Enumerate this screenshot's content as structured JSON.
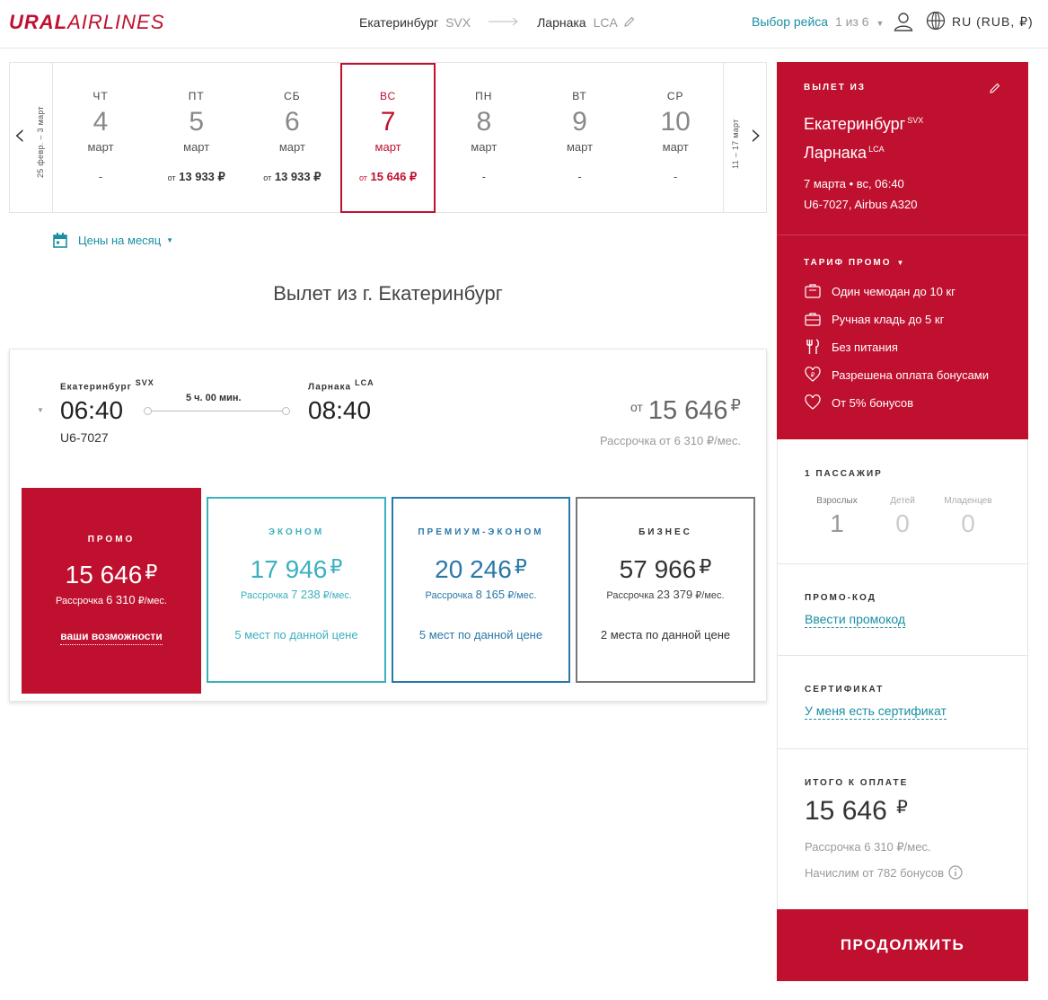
{
  "header": {
    "logo_bold": "URAL",
    "logo_thin": "AIRLINES",
    "from_city": "Екатеринбург",
    "from_code": "SVX",
    "to_city": "Ларнака",
    "to_code": "LCA",
    "flight_select_label": "Выбор рейса",
    "flight_select_count": "1 из 6",
    "language": "RU (RUB, ₽)"
  },
  "date_strip": {
    "prev_range": "25 февр. – 3 март",
    "next_range": "11 – 17 март",
    "days": [
      {
        "dow": "чт",
        "num": "4",
        "month": "март",
        "price_prefix": "",
        "price": "-"
      },
      {
        "dow": "пт",
        "num": "5",
        "month": "март",
        "price_prefix": "от",
        "price": "13 933 ₽"
      },
      {
        "dow": "сб",
        "num": "6",
        "month": "март",
        "price_prefix": "от",
        "price": "13 933 ₽"
      },
      {
        "dow": "вс",
        "num": "7",
        "month": "март",
        "price_prefix": "от",
        "price": "15 646 ₽"
      },
      {
        "dow": "пн",
        "num": "8",
        "month": "март",
        "price_prefix": "",
        "price": "-"
      },
      {
        "dow": "вт",
        "num": "9",
        "month": "март",
        "price_prefix": "",
        "price": "-"
      },
      {
        "dow": "ср",
        "num": "10",
        "month": "март",
        "price_prefix": "",
        "price": "-"
      }
    ],
    "selected_index": 3
  },
  "month_prices_label": "Цены на месяц",
  "section_title": "Вылет из г. Екатеринбург",
  "flight": {
    "from_city": "Екатеринбург",
    "from_code": "SVX",
    "to_city": "Ларнака",
    "to_code": "LCA",
    "dep_time": "06:40",
    "arr_time": "08:40",
    "duration": "5 ч. 00 мин.",
    "flight_no": "U6-7027",
    "price_prefix": "от",
    "price": "15 646",
    "currency": "₽",
    "installment": "Рассрочка от 6 310 ₽/мес."
  },
  "fares": {
    "promo": {
      "name": "Промо",
      "price": "15 646",
      "currency": "₽",
      "inst_prefix": "Рассрочка",
      "inst_value": "6 310",
      "inst_suffix": "₽/мес.",
      "link": "ваши возможности"
    },
    "econ": {
      "name": "Эконом",
      "price": "17 946",
      "currency": "₽",
      "inst_prefix": "Рассрочка",
      "inst_value": "7 238",
      "inst_suffix": "₽/мес.",
      "avail": "5 мест по данной цене"
    },
    "prem": {
      "name": "Премиум-эконом",
      "price": "20 246",
      "currency": "₽",
      "inst_prefix": "Рассрочка",
      "inst_value": "8 165",
      "inst_suffix": "₽/мес.",
      "avail": "5 мест по данной цене"
    },
    "biz": {
      "name": "Бизнес",
      "price": "57 966",
      "currency": "₽",
      "inst_prefix": "Рассрочка",
      "inst_value": "23 379",
      "inst_suffix": "₽/мес.",
      "avail": "2 места по данной цене"
    }
  },
  "sidebar": {
    "departure_label": "Вылет из",
    "from_city": "Екатеринбург",
    "from_code": "SVX",
    "to_city": "Ларнака",
    "to_code": "LCA",
    "date_line": "7 марта • вс, 06:40",
    "flight_line": "U6-7027, Airbus A320",
    "tariff_label": "Тариф промо",
    "features": [
      {
        "icon": "suitcase-icon",
        "text": "Один чемодан до 10 кг"
      },
      {
        "icon": "hand-luggage-icon",
        "text": "Ручная кладь до 5 кг"
      },
      {
        "icon": "meal-icon",
        "text": "Без питания"
      },
      {
        "icon": "bonus-heart-icon",
        "text": "Разрешена оплата бонусами"
      },
      {
        "icon": "heart-icon",
        "text": "От 5% бонусов"
      }
    ],
    "pax_label": "1 пассажир",
    "adults_label": "Взрослых",
    "adults": "1",
    "children_label": "Детей",
    "children": "0",
    "infants_label": "Младенцев",
    "infants": "0",
    "promo_label": "Промо-код",
    "promo_link": "Ввести промокод",
    "cert_label": "Сертификат",
    "cert_link": "У меня есть сертификат",
    "total_label": "Итого к оплате",
    "total_price": "15 646",
    "total_currency": "₽",
    "total_installment": "Рассрочка 6 310 ₽/мес.",
    "bonus_text": "Начислим от 782 бонусов",
    "continue_label": "ПРОДОЛЖИТЬ"
  },
  "colors": {
    "brand": "#c0102f",
    "link": "#1a8fa3",
    "econ": "#3bb0bf",
    "prem": "#2a78a8",
    "biz": "#777777"
  }
}
